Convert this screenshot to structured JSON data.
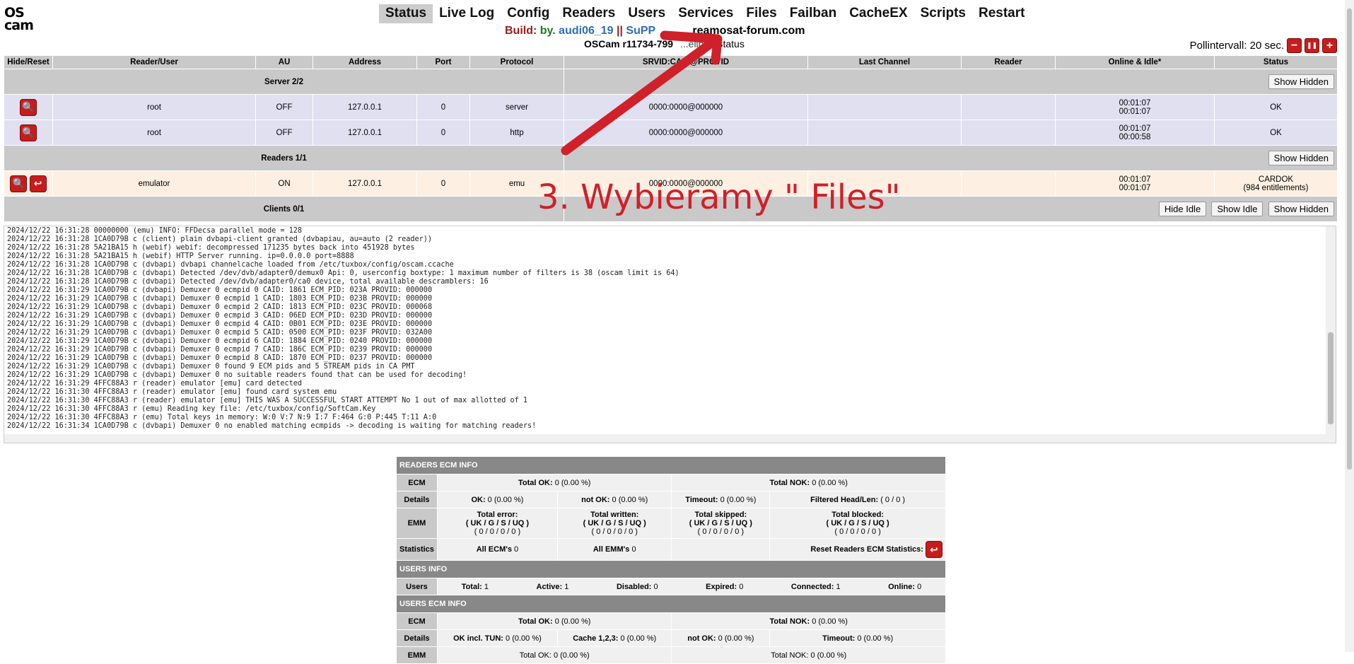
{
  "logo": {
    "line1": "OS",
    "line2": "cam"
  },
  "nav": [
    "Status",
    "Live Log",
    "Config",
    "Readers",
    "Users",
    "Services",
    "Files",
    "Failban",
    "CacheEX",
    "Scripts",
    "Restart"
  ],
  "build": {
    "label": "Build:",
    "by": "by.",
    "author": "audi06_19",
    "sep": "||",
    "sup": "SuPP",
    "site": "reamosat-forum.com"
  },
  "subline": {
    "version": "OSCam r11734-799",
    "mid": "...eline",
    "status": "Status"
  },
  "poll": {
    "label": "Pollintervall: 20 sec.",
    "minus": "−",
    "pause": "❚❚",
    "plus": "+"
  },
  "table": {
    "headers": [
      "Hide/Reset",
      "Reader/User",
      "AU",
      "Address",
      "Port",
      "Protocol",
      "SRVID:CAID@PROVID",
      "Last Channel",
      "Reader",
      "Online & Idle*",
      "Status"
    ],
    "server_group": "Server 2/2",
    "readers_group": "Readers 1/1",
    "clients_group": "Clients 0/1",
    "show_hidden": "Show Hidden",
    "hide_idle": "Hide Idle",
    "show_idle": "Show Idle",
    "servers": [
      {
        "user": "root",
        "au": "OFF",
        "address": "127.0.0.1",
        "port": "0",
        "protocol": "server",
        "srvid": "0000:0000@000000",
        "online": "00:01:07",
        "idle": "00:01:07",
        "status": "OK"
      },
      {
        "user": "root",
        "au": "OFF",
        "address": "127.0.0.1",
        "port": "0",
        "protocol": "http",
        "srvid": "0000:0000@000000",
        "online": "00:01:07",
        "idle": "00:00:58",
        "status": "OK"
      }
    ],
    "readers": [
      {
        "user": "emulator",
        "au": "ON",
        "address": "127.0.0.1",
        "port": "0",
        "protocol": "emu",
        "srvid": "0000:0000@000000",
        "online": "00:01:07",
        "idle": "00:01:07",
        "status": "CARDOK",
        "status2": "(984 entitlements)"
      }
    ]
  },
  "annotation": "3. Wybieramy \" Files\"",
  "log": [
    "2024/12/22 16:31:28 00000000 (emu) INFO: FFDecsa parallel mode = 128",
    "2024/12/22 16:31:28 1CA0D79B c (client) plain dvbapi-client granted (dvbapiau, au=auto (2 reader))",
    "2024/12/22 16:31:28 5A21BA15 h (webif) webif: decompressed 171235 bytes back into 451928 bytes",
    "2024/12/22 16:31:28 5A21BA15 h (webif) HTTP Server running. ip=0.0.0.0 port=8888",
    "2024/12/22 16:31:28 1CA0D79B c (dvbapi) dvbapi channelcache loaded from /etc/tuxbox/config/oscam.ccache",
    "2024/12/22 16:31:28 1CA0D79B c (dvbapi) Detected /dev/dvb/adapter0/demux0 Api: 0, userconfig boxtype: 1 maximum number of filters is 38 (oscam limit is 64)",
    "2024/12/22 16:31:28 1CA0D79B c (dvbapi) Detected /dev/dvb/adapter0/ca0 device, total available descramblers: 16",
    "2024/12/22 16:31:29 1CA0D79B c (dvbapi) Demuxer 0 ecmpid 0 CAID: 1861 ECM_PID: 023A PROVID: 000000",
    "2024/12/22 16:31:29 1CA0D79B c (dvbapi) Demuxer 0 ecmpid 1 CAID: 1803 ECM_PID: 023B PROVID: 000000",
    "2024/12/22 16:31:29 1CA0D79B c (dvbapi) Demuxer 0 ecmpid 2 CAID: 1813 ECM_PID: 023C PROVID: 000068",
    "2024/12/22 16:31:29 1CA0D79B c (dvbapi) Demuxer 0 ecmpid 3 CAID: 06ED ECM_PID: 023D PROVID: 000000",
    "2024/12/22 16:31:29 1CA0D79B c (dvbapi) Demuxer 0 ecmpid 4 CAID: 0B01 ECM_PID: 023E PROVID: 000000",
    "2024/12/22 16:31:29 1CA0D79B c (dvbapi) Demuxer 0 ecmpid 5 CAID: 0500 ECM_PID: 023F PROVID: 032A00",
    "2024/12/22 16:31:29 1CA0D79B c (dvbapi) Demuxer 0 ecmpid 6 CAID: 1884 ECM_PID: 0240 PROVID: 000000",
    "2024/12/22 16:31:29 1CA0D79B c (dvbapi) Demuxer 0 ecmpid 7 CAID: 186C ECM_PID: 0239 PROVID: 000000",
    "2024/12/22 16:31:29 1CA0D79B c (dvbapi) Demuxer 0 ecmpid 8 CAID: 1870 ECM_PID: 0237 PROVID: 000000",
    "2024/12/22 16:31:29 1CA0D79B c (dvbapi) Demuxer 0 found 9 ECM pids and 5 STREAM pids in CA PMT",
    "2024/12/22 16:31:29 1CA0D79B c (dvbapi) Demuxer 0 no suitable readers found that can be used for decoding!",
    "2024/12/22 16:31:29 4FFC88A3 r (reader) emulator [emu] card detected",
    "2024/12/22 16:31:30 4FFC88A3 r (reader) emulator [emu] found card system emu",
    "2024/12/22 16:31:30 4FFC88A3 r (reader) emulator [emu] THIS WAS A SUCCESSFUL START ATTEMPT No 1 out of max allotted of 1",
    "2024/12/22 16:31:30 4FFC88A3 r (emu) Reading key file: /etc/tuxbox/config/SoftCam.Key",
    "2024/12/22 16:31:30 4FFC88A3 r (emu) Total keys in memory: W:0 V:7 N:9 I:7 F:464 G:0 P:445 T:11 A:0",
    "2024/12/22 16:31:34 1CA0D79B c (dvbapi) Demuxer 0 no enabled matching ecmpids -> decoding is waiting for matching readers!"
  ],
  "stats": {
    "readers_ecm_info": "READERS ECM INFO",
    "ecm": "ECM",
    "details": "Details",
    "emm": "EMM",
    "statistics": "Statistics",
    "total_ok": "Total OK:",
    "total_ok_val": "0 (0.00 %)",
    "total_nok": "Total NOK:",
    "total_nok_val": "0 (0.00 %)",
    "ok": "OK:",
    "ok_val": "0 (0.00 %)",
    "not_ok": "not OK:",
    "not_ok_val": "0 (0.00 %)",
    "timeout": "Timeout:",
    "timeout_val": "0 (0.00 %)",
    "filtered": "Filtered Head/Len:",
    "filtered_val": "( 0 / 0 )",
    "total_error": "Total error:",
    "total_written": "Total written:",
    "total_skipped": "Total skipped:",
    "total_blocked": "Total blocked:",
    "uk_line": "( UK / G / S / UQ )",
    "zero_line": "( 0 / 0 / 0 / 0 )",
    "all_ecms": "All ECM's",
    "all_ecms_val": "0",
    "all_emms": "All EMM's",
    "all_emms_val": "0",
    "reset_label": "Reset Readers ECM Statistics:",
    "users_info": "USERS INFO",
    "users": "Users",
    "total": "Total:",
    "total_val": "1",
    "active": "Active:",
    "active_val": "1",
    "disabled": "Disabled:",
    "disabled_val": "0",
    "expired": "Expired:",
    "expired_val": "0",
    "connected": "Connected:",
    "connected_val": "1",
    "online": "Online:",
    "online_val": "0",
    "users_ecm_info": "USERS ECM INFO",
    "ok_tun": "OK incl. TUN:",
    "ok_tun_val": "0 (0.00 %)",
    "cache": "Cache 1,2,3:",
    "cache_val": "0 (0.00 %)",
    "emm_partial": "EMM",
    "total_ok_partial": "Total OK: 0 (0.00 %)",
    "total_nok_partial": "Total NOK: 0 (0.00 %)"
  }
}
